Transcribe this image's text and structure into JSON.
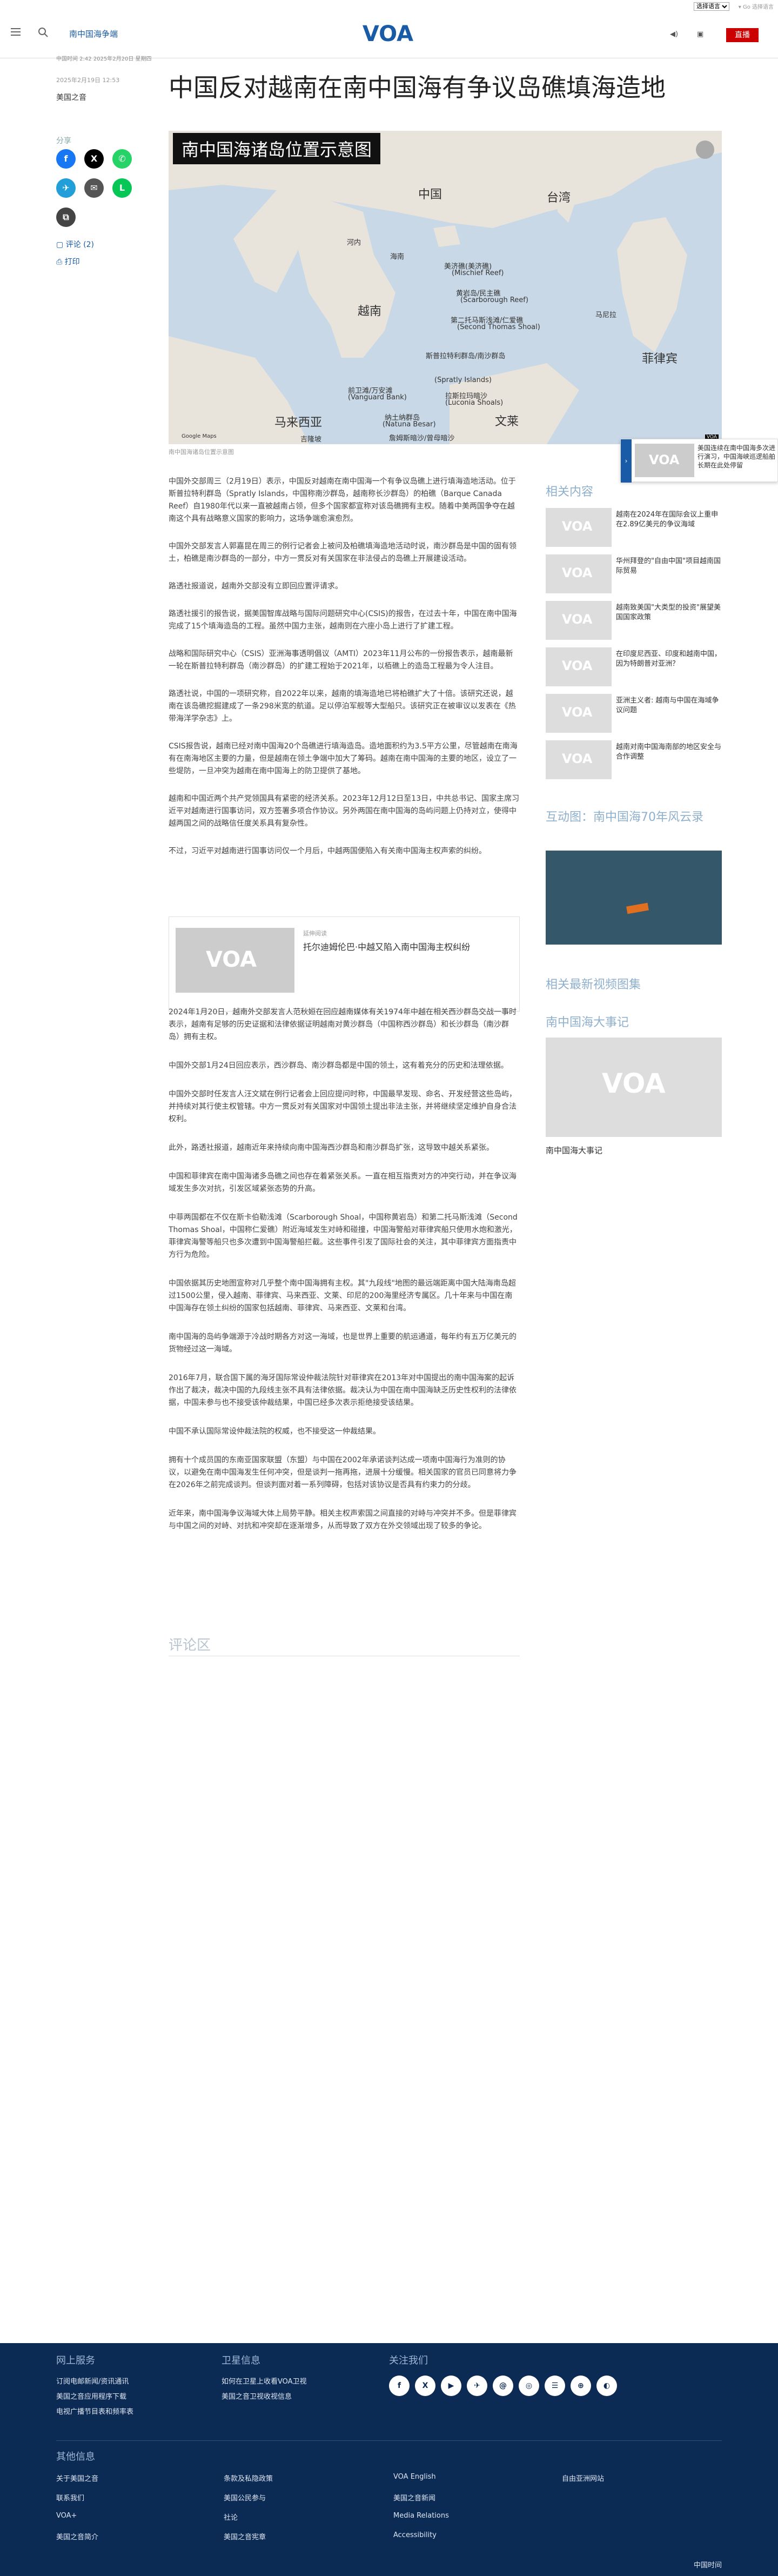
{
  "util": {
    "lang_select": "选择语言",
    "right": "▾ Go 选择语言"
  },
  "header": {
    "section": "南中国海争端",
    "logo": "VOA",
    "live": "直播"
  },
  "article": {
    "meta": "中国时间 2:42 2025年2月20日 星期四",
    "date": "2025年2月19日 12:53",
    "byline": "美国之音",
    "title": "中国反对越南在南中国海有争议岛礁填海造地",
    "share_label": "分享",
    "comments_link": "评论 (2)",
    "print_link": "打印",
    "map_title": "南中国海诸岛位置示意图",
    "map_labels": {
      "china": "中国",
      "taiwan": "台湾",
      "hainan": "海南",
      "vietnam": "越南",
      "philippines": "菲律宾",
      "malaysia": "马来西亚",
      "brunei": "文莱",
      "manila": "马尼拉",
      "hanoi": "河内",
      "kl": "吉隆坡",
      "mischief": "美济礁(美济礁)",
      "mischief_en": "(Mischief Reef)",
      "scarborough": "黄岩岛/民主礁",
      "scarborough_en": "(Scarborough Reef)",
      "second_thomas": "第二托马斯浅滩/仁爱礁",
      "second_thomas_en": "(Second Thomas Shoal)",
      "spratly": "斯普拉特利群岛/南沙群岛",
      "spratly_en": "(Spratly Islands)",
      "vanguard": "前卫滩/万安滩",
      "vanguard_en": "(Vanguard Bank)",
      "laslama": "拉斯拉玛暗沙",
      "laslama_en": "(Luconia Shoals)",
      "natuna": "纳土纳群岛",
      "natuna_en": "(Natuna Besar)",
      "james": "詹姆斯暗沙/曾母暗沙",
      "james_en": "(James Shoal)",
      "credit": "Google Maps",
      "badge": "VOA"
    },
    "caption": "南中国海诸岛位置示意图",
    "paragraphs_1": [
      "中国外交部周三（2月19日）表示，中国反对越南在南中国海一个有争议岛礁上进行填海造地活动。位于斯普拉特利群岛（Spratly Islands，中国称南沙群岛，越南称长沙群岛）的柏礁（Barque Canada Reef）自1980年代以来一直被越南占领，但多个国家都宣称对该岛礁拥有主权。随着中美两国争夺在越南这个具有战略意义国家的影响力，这场争端愈演愈烈。",
      "中国外交部发言人郭嘉昆在周三的例行记者会上被问及柏礁填海造地活动时说，南沙群岛是中国的固有领土，柏礁是南沙群岛的一部分，中方一贯反对有关国家在非法侵占的岛礁上开展建设活动。",
      "路透社报道说，越南外交部没有立即回应置评请求。",
      "路透社援引的报告说，据美国智库战略与国际问题研究中心(CSIS)的报告，在过去十年，中国在南中国海完成了15个填海造岛的工程。虽然中国力主张，越南则在六座小岛上进行了扩建工程。",
      "战略和国际研究中心（CSIS）亚洲海事透明倡议（AMTI）2023年11月公布的一份报告表示，越南最新一轮在斯普拉特利群岛（南沙群岛）的扩建工程始于2021年，以栢礁上的造岛工程最为令人注目。",
      "路透社说，中国的一项研究称，自2022年以来，越南的填海造地已将柏礁扩大了十倍。该研究还说，越南在该岛礁挖掘建成了一条298米宽的航道。足以停泊军舰等大型船只。该研究正在被审议以发表在《热带海洋学杂志》上。",
      "CSIS报告说，越南已经对南中国海20个岛礁进行填海造岛。造地面积约为3.5平方公里，尽管越南在南海有在南海地区主要的力量，但是越南在领土争端中加大了筹码。越南在南中国海的主要的地区，设立了一些堤防，一旦冲突为越南在南中国海上的防卫提供了基地。",
      "越南和中国近两个共产党领国具有紧密的经济关系。2023年12月12日至13日，中共总书记、国家主席习近平对越南进行国事访问，双方签署多项合作协议。另外两国在南中国海的岛屿问题上仍持对立，使得中越两国之间的战略信任度关系具有复杂性。",
      "不过，习近平对越南进行国事访问仅一个月后，中越两国便陷入有关南中国海主权声索的纠纷。"
    ],
    "related": {
      "kicker": "延伸阅读",
      "text": "托尔迪姆伦巴·中越又陷入南中国海主权纠纷"
    },
    "paragraphs_2": [
      "2024年1月20日，越南外交部发言人范秋姮在回应越南媒体有关1974年中越在相关西沙群岛交战一事时表示，越南有足够的历史证据和法律依据证明越南对黄沙群岛（中国称西沙群岛）和长沙群岛（南沙群岛）拥有主权。",
      "中国外交部1月24日回应表示，西沙群岛、南沙群岛都是中国的领土，这有着充分的历史和法理依据。",
      "中国外交部时任发言人汪文斌在例行记者会上回应提问时称，中国最早发现、命名、开发经营这些岛屿，并持续对其行使主权管辖。中方一贯反对有关国家对中国领土提出非法主张，并将继续坚定维护自身合法权利。",
      "此外，路透社报道，越南近年来持续向南中国海西沙群岛和南沙群岛扩张，这导致中越关系紧张。",
      "中国和菲律宾在南中国海诸多岛礁之间也存在着紧张关系。一直在相互指责对方的冲突行动，并在争议海域发生多次对抗，引发区域紧张态势的升高。",
      "中菲两国都在不仅在斯卡伯勒浅滩（Scarborough Shoal，中国称黄岩岛）和第二托马斯浅滩（Second Thomas Shoal，中国称仁爱礁）附近海域发生对峙和碰撞，中国海警船对菲律宾船只使用水炮和激光，菲律宾海警等船只也多次遭到中国海警船拦截。这些事件引发了国际社会的关注，其中菲律宾方面指责中方行为危险。",
      "中国依据其历史地图宣称对几乎整个南中国海拥有主权。其\"九段线\"地图的最远端距离中国大陆海南岛超过1500公里，侵入越南、菲律宾、马来西亚、文莱、印尼的200海里经济专属区。几十年来与中国在南中国海存在领土纠纷的国家包括越南、菲律宾、马来西亚、文莱和台湾。",
      "南中国海的岛屿争端源于冷战时期各方对这一海域，也是世界上重要的航运通道，每年约有五万亿美元的货物经过这一海域。",
      "2016年7月，联合国下属的海牙国际常设仲裁法院针对菲律宾在2013年对中国提出的南中国海案的起诉作出了裁决，裁决中国的九段线主张不具有法律依据。裁决认为中国在南中国海缺乏历史性权利的法律依据，中国未参与也不接受该仲裁结果，中国已经多次表示拒绝接受该结果。",
      "中国不承认国际常设仲裁法院的权威，也不接受这一仲裁结果。",
      "拥有十个成员国的东南亚国家联盟（东盟）与中国在2002年承诺谈判达成一项南中国海行为准则的协议，以避免在南中国海发生任何冲突，但是谈判一拖再拖，进展十分缓慢。相关国家的官员已同意将力争在2026年之前完成谈判。但谈判面对着一系列障碍，包括对该协议是否具有约束力的分歧。",
      "近年来，南中国海争议海域大体上局势平静。相关主权声索国之间直接的对峙与冲突并不多。但是菲律宾与中国之间的对峙、对抗和冲突却在逐渐增多，从而导致了双方在外交领域出现了较多的争论。"
    ],
    "comments_title": "评论区"
  },
  "rail": {
    "related_title": "相关内容",
    "items": [
      "越南在2024年在国际会议上重申在2.89亿美元的争议海域",
      "华州拜登的\"自由中国\"项目越南国际贸易",
      "越南致美国\"大类型的投资\"展望美国国家政策",
      "在印度尼西亚、印度和越南中国，因为特朗普对亚洲？",
      "亚洲主义者: 越南与中国在海域争议问题",
      "越南对南中国海南部的地区安全与合作调整"
    ],
    "interactive_title": "互动图：南中国海70年风云录",
    "video_title": "相关最新视频图集",
    "events_title": "南中国海大事记",
    "events_caption": "南中国海大事记"
  },
  "sticky": {
    "text": "美国连续在南中国海多次进行演习，中国海峡巡逻船舶长期在此处停留"
  },
  "footer": {
    "sections": [
      {
        "title": "网上服务",
        "links": [
          "订阅电邮新闻/资讯通讯",
          "美国之音应用程序下载",
          "电视广播节目表和频率表"
        ]
      },
      {
        "title": "卫星信息",
        "links": [
          "如何在卫星上收看VOA卫视",
          "美国之音卫视收视信息"
        ]
      },
      {
        "title": "关注我们",
        "social": [
          "f",
          "X",
          "▶",
          "✈",
          "@",
          "◎",
          "☰",
          "⊕",
          "◐"
        ]
      }
    ],
    "other_title": "其他信息",
    "other_links": [
      "关于美国之音",
      "联系我们",
      "VOA+",
      "美国之音简介",
      "条款及私隐政策",
      "美国公民参与",
      "社论",
      "美国之音宪章",
      "VOA English",
      "美国之音新闻",
      "Media Relations",
      "Accessibility",
      "自由亚洲网站"
    ],
    "bottom": "中国时间"
  },
  "colors": {
    "brand": "#1a5ba8",
    "live": "#cc0000",
    "footer": "#0b2a54"
  }
}
